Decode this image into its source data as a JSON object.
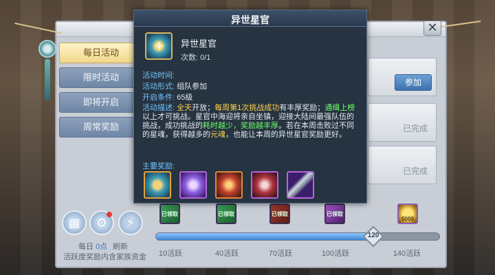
{
  "tabs": [
    {
      "label": "每日活动"
    },
    {
      "label": "限时活动"
    },
    {
      "label": "即将开启"
    },
    {
      "label": "周常奖励"
    }
  ],
  "close_label": "✕",
  "right_list": {
    "join_label": "参加",
    "done_label": "已完成"
  },
  "bottom": {
    "daily_label": "每日",
    "daily_count": "0点",
    "refresh_label": "刷新",
    "note": "活跃度奖励内含家族资金",
    "progress_marker": "120",
    "progress_fraction": 0.78,
    "chest_tag": "已领取",
    "gold_chest_amount": "5000",
    "milestones": [
      "10活跃",
      "40活跃",
      "70活跃",
      "100活跃",
      "140活跃"
    ]
  },
  "popup": {
    "title": "异世星官",
    "activity_name": "异世星官",
    "count_label": "次数: 0/1",
    "time_label": "活动时间:",
    "time_value": "",
    "form_label": "活动形式:",
    "form_value": "组队参加",
    "cond_label": "开启条件:",
    "cond_value": "65级",
    "desc_label": "活动描述:",
    "desc_parts": {
      "p1": "全天",
      "p2": "开放；",
      "p3": "每周第1次挑战成功",
      "p4": "有丰厚奖励；",
      "p5": "通缉上榜",
      "p6": "以上才可挑战。星官中海迎将亲自坐镇，迎接大陆间最强队伍的挑战，成功挑战的",
      "p7": "耗时越少，奖励越丰厚",
      "p8": "。若在本周击败过不同的星魂，获得越多的",
      "p9": "元魂",
      "p10": "，也能让本周的异世星官奖励更好。"
    },
    "rewards_label": "主要奖励:"
  },
  "colors": {
    "highlight_yellow": "#ffd451",
    "highlight_green": "#6dff6a",
    "label_blue": "#71c4ff"
  }
}
